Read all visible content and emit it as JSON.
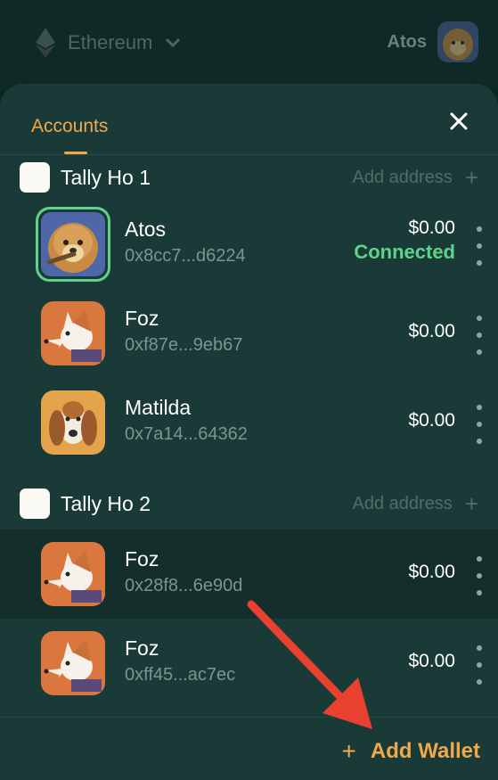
{
  "header": {
    "network_label": "Ethereum",
    "account_name": "Atos"
  },
  "panel": {
    "tab_label": "Accounts"
  },
  "groups": [
    {
      "name": "Tally Ho 1",
      "add_address_label": "Add address",
      "accounts": [
        {
          "name": "Atos",
          "address": "0x8cc7...d6224",
          "balance": "$0.00",
          "status": "Connected",
          "selected": true
        },
        {
          "name": "Foz",
          "address": "0xf87e...9eb67",
          "balance": "$0.00"
        },
        {
          "name": "Matilda",
          "address": "0x7a14...64362",
          "balance": "$0.00"
        }
      ]
    },
    {
      "name": "Tally Ho 2",
      "add_address_label": "Add address",
      "accounts": [
        {
          "name": "Foz",
          "address": "0x28f8...6e90d",
          "balance": "$0.00"
        },
        {
          "name": "Foz",
          "address": "0xff45...ac7ec",
          "balance": "$0.00"
        }
      ]
    }
  ],
  "footer": {
    "add_wallet_label": "Add Wallet",
    "add_wallet_icon": "+"
  },
  "colors": {
    "accent": "#f0a84a",
    "connected": "#5fd28b",
    "panel_bg": "#193a37",
    "annotation_arrow": "#e8412f"
  }
}
